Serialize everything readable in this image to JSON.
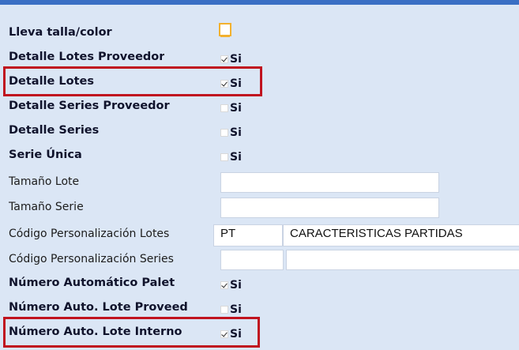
{
  "form": {
    "rows": [
      {
        "label": "Lleva talla/color"
      },
      {
        "label": "Detalle Lotes Proveedor",
        "checked": true,
        "option": "Si"
      },
      {
        "label": "Detalle Lotes",
        "checked": true,
        "option": "Si"
      },
      {
        "label": "Detalle Series Proveedor",
        "checked": false,
        "option": "Si"
      },
      {
        "label": "Detalle Series",
        "checked": false,
        "option": "Si"
      },
      {
        "label": "Serie Única",
        "checked": false,
        "option": "Si"
      },
      {
        "label": "Tamaño Lote",
        "value": ""
      },
      {
        "label": "Tamaño Serie",
        "value": ""
      },
      {
        "label": "Código Personalización Lotes",
        "code": "PT",
        "description": "CARACTERISTICAS PARTIDAS"
      },
      {
        "label": "Código Personalización Series",
        "code": "",
        "description": ""
      },
      {
        "label": "Número Automático Palet",
        "checked": true,
        "option": "Si"
      },
      {
        "label": "Número Auto. Lote Proveed",
        "checked": false,
        "option": "Si"
      },
      {
        "label": "Número Auto. Lote Interno",
        "checked": true,
        "option": "Si"
      }
    ]
  },
  "colors": {
    "background": "#dbe6f5",
    "topbar": "#3a6fc4",
    "highlight": "#c0131f",
    "focus_checkbox": "#f3b12e"
  }
}
